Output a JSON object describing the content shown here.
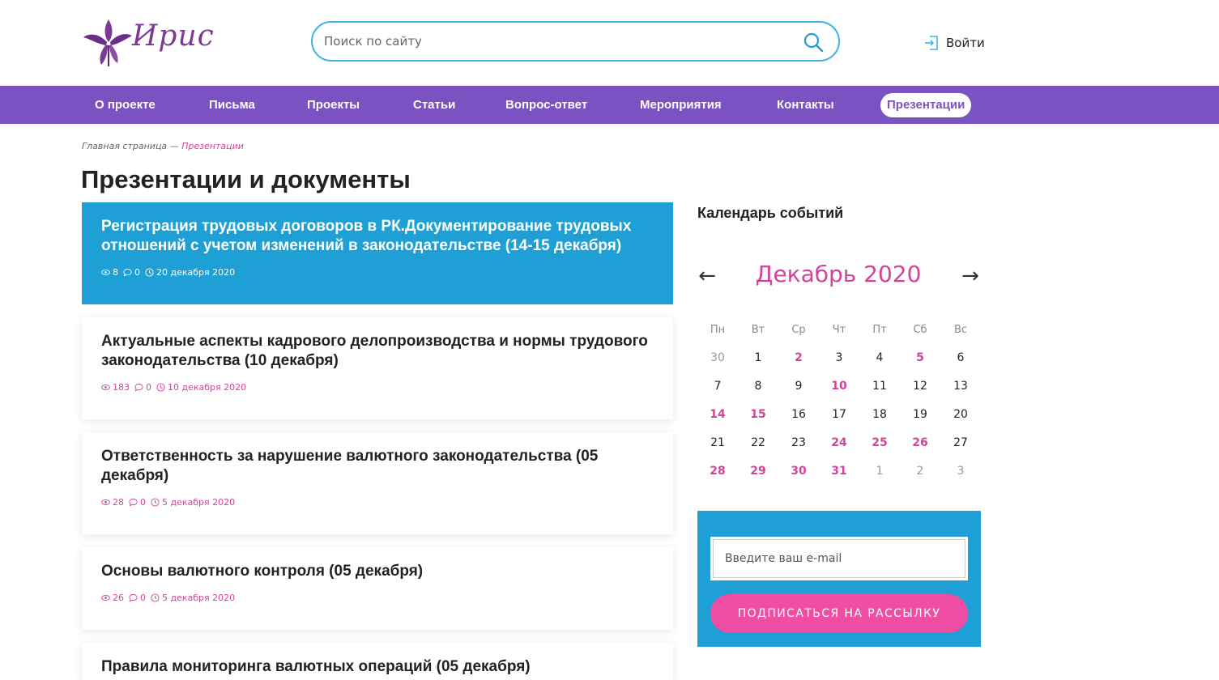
{
  "header": {
    "logo_text": "Ирис",
    "search_placeholder": "Поиск по сайту",
    "login_label": "Войти"
  },
  "nav": {
    "items": [
      {
        "label": "О проекте"
      },
      {
        "label": "Письма"
      },
      {
        "label": "Проекты"
      },
      {
        "label": "Статьи"
      },
      {
        "label": "Вопрос-ответ"
      },
      {
        "label": "Мероприятия"
      },
      {
        "label": "Контакты"
      },
      {
        "label": "Презентации",
        "active": true
      }
    ]
  },
  "breadcrumb": {
    "home": "Главная страница",
    "separator": " — ",
    "current": "Презентации"
  },
  "page_title": "Презентации и документы",
  "articles": [
    {
      "title": "Регистрация трудовых договоров в РК.Документирование трудовых отношений с учетом изменений в законодательстве (14-15 декабря)",
      "views": "8",
      "comments": "0",
      "date": "20 декабря 2020",
      "featured": true
    },
    {
      "title": "Актуальные аспекты кадрового делопроизводства и нормы трудового законодательства (10 декабря)",
      "views": "183",
      "comments": "0",
      "date": "10 декабря 2020"
    },
    {
      "title": "Ответственность за нарушение валютного законодательства (05 декабря)",
      "views": "28",
      "comments": "0",
      "date": "5 декабря 2020"
    },
    {
      "title": "Основы валютного контроля (05 декабря)",
      "views": "26",
      "comments": "0",
      "date": "5 декабря 2020"
    },
    {
      "title": "Правила мониторинга валютных операций (05 декабря)",
      "views": "",
      "comments": "",
      "date": ""
    }
  ],
  "calendar": {
    "heading": "Календарь событий",
    "prev_label": "←",
    "next_label": "→",
    "month_label": "Декабрь 2020",
    "weekdays": [
      "Пн",
      "Вт",
      "Ср",
      "Чт",
      "Пт",
      "Сб",
      "Вс"
    ],
    "weeks": [
      [
        {
          "d": "30",
          "muted": true
        },
        {
          "d": "1"
        },
        {
          "d": "2",
          "event": true
        },
        {
          "d": "3"
        },
        {
          "d": "4"
        },
        {
          "d": "5",
          "event": true
        },
        {
          "d": "6"
        }
      ],
      [
        {
          "d": "7"
        },
        {
          "d": "8"
        },
        {
          "d": "9"
        },
        {
          "d": "10",
          "event": true
        },
        {
          "d": "11"
        },
        {
          "d": "12"
        },
        {
          "d": "13"
        }
      ],
      [
        {
          "d": "14",
          "event": true
        },
        {
          "d": "15",
          "event": true
        },
        {
          "d": "16"
        },
        {
          "d": "17"
        },
        {
          "d": "18"
        },
        {
          "d": "19"
        },
        {
          "d": "20"
        }
      ],
      [
        {
          "d": "21"
        },
        {
          "d": "22"
        },
        {
          "d": "23"
        },
        {
          "d": "24",
          "event": true
        },
        {
          "d": "25",
          "event": true
        },
        {
          "d": "26",
          "event": true
        },
        {
          "d": "27"
        }
      ],
      [
        {
          "d": "28",
          "event": true
        },
        {
          "d": "29",
          "event": true
        },
        {
          "d": "30",
          "event": true
        },
        {
          "d": "31",
          "event": true
        },
        {
          "d": "1",
          "muted": true
        },
        {
          "d": "2",
          "muted": true
        },
        {
          "d": "3",
          "muted": true
        }
      ]
    ]
  },
  "subscribe": {
    "email_placeholder": "Введите ваш e-mail",
    "button_label": "ПОДПИСАТЬСЯ НА РАССЫЛКУ"
  },
  "colors": {
    "nav_bg": "#7a52c1",
    "featured_bg": "#1e9fd6",
    "accent_pink": "#d1449a",
    "button_pink": "#ef4ea4",
    "search_border": "#3fb3e3"
  }
}
